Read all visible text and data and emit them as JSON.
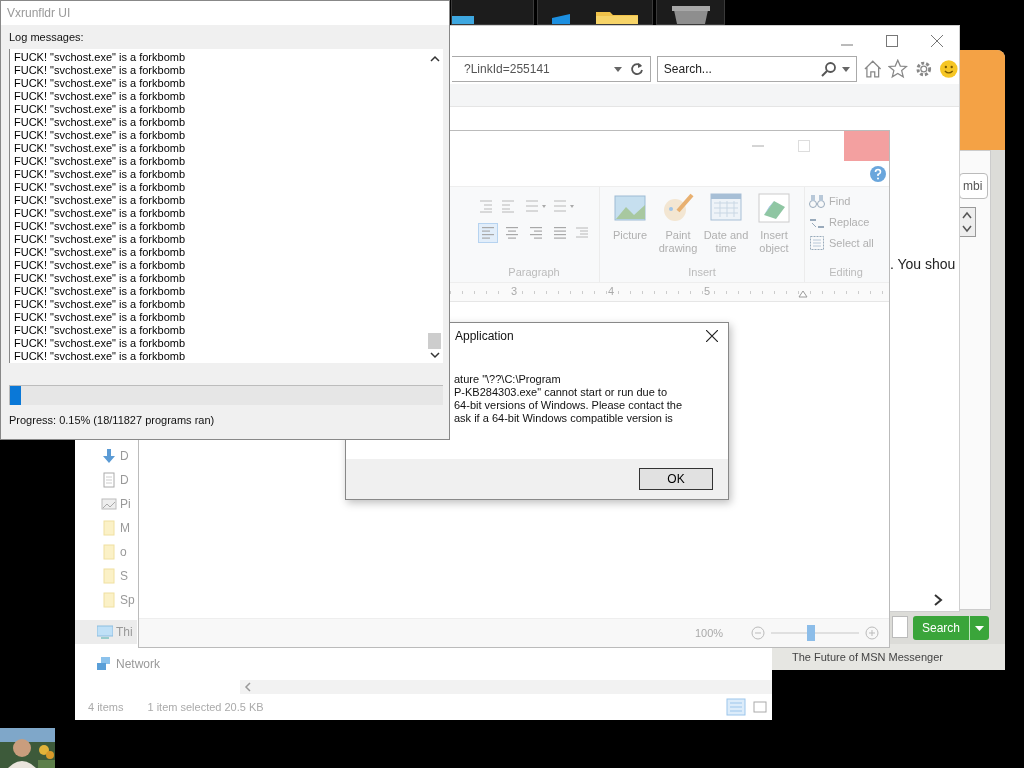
{
  "msn_window": {
    "field_value": "mbi",
    "search_button": "Search",
    "status": "The Future of MSN Messenger"
  },
  "explorer": {
    "nav_items": [
      {
        "label": "D",
        "kind": "download",
        "selected": false
      },
      {
        "label": "D",
        "kind": "document",
        "selected": false
      },
      {
        "label": "Pi",
        "kind": "picture",
        "selected": false
      },
      {
        "label": "M",
        "kind": "folder",
        "selected": false
      },
      {
        "label": "o",
        "kind": "folder",
        "selected": false
      },
      {
        "label": "S",
        "kind": "folder",
        "selected": false
      },
      {
        "label": "Sp",
        "kind": "folder",
        "selected": false
      },
      {
        "label": "Thi",
        "kind": "pc",
        "selected": true
      },
      {
        "label": "Network",
        "kind": "network",
        "selected": false
      }
    ],
    "status": [
      "4 items",
      "1 item selected  20.5 KB"
    ]
  },
  "browser": {
    "address": "?LinkId=255141",
    "search_placeholder": "Search...",
    "page_text": ". You shou"
  },
  "wordpad": {
    "alignment": [
      {
        "kind": "left",
        "selected": true
      },
      {
        "kind": "center",
        "selected": false
      },
      {
        "kind": "right",
        "selected": false
      },
      {
        "kind": "justify",
        "selected": false
      }
    ],
    "groups": [
      {
        "name": "Paragraph"
      },
      {
        "name": "Insert"
      },
      {
        "name": "Editing"
      }
    ],
    "insert_buttons": [
      {
        "label": "Picture",
        "kind": "picture"
      },
      {
        "label": "Paint drawing",
        "kind": "paint"
      },
      {
        "label": "Date and time",
        "kind": "calendar"
      },
      {
        "label": "Insert object",
        "kind": "object"
      }
    ],
    "editing_buttons": [
      {
        "label": "Find",
        "kind": "find"
      },
      {
        "label": "Replace",
        "kind": "replace"
      },
      {
        "label": "Select all",
        "kind": "select"
      }
    ],
    "ruler": [
      "3",
      "4",
      "5"
    ],
    "zoom": "100%",
    "zoom_slider": {
      "level": 0.45
    }
  },
  "dialog": {
    "title": "Application",
    "lines": [
      "ature \"\\??\\C:\\Program",
      "P-KB284303.exe\" cannot start or run due to",
      "64-bit versions of Windows. Please contact the",
      "ask if a 64-bit Windows compatible version is"
    ],
    "button": "OK"
  },
  "log_window": {
    "title": "Vxrunfldr UI",
    "label": "Log messages:",
    "lines": [
      "FUCK! \"svchost.exe\" is a forkbomb",
      "FUCK! \"svchost.exe\" is a forkbomb",
      "FUCK! \"svchost.exe\" is a forkbomb",
      "FUCK! \"svchost.exe\" is a forkbomb",
      "FUCK! \"svchost.exe\" is a forkbomb",
      "FUCK! \"svchost.exe\" is a forkbomb",
      "FUCK! \"svchost.exe\" is a forkbomb",
      "FUCK! \"svchost.exe\" is a forkbomb",
      "FUCK! \"svchost.exe\" is a forkbomb",
      "FUCK! \"svchost.exe\" is a forkbomb",
      "FUCK! \"svchost.exe\" is a forkbomb",
      "FUCK! \"svchost.exe\" is a forkbomb",
      "FUCK! \"svchost.exe\" is a forkbomb",
      "FUCK! \"svchost.exe\" is a forkbomb",
      "FUCK! \"svchost.exe\" is a forkbomb",
      "FUCK! \"svchost.exe\" is a forkbomb",
      "FUCK! \"svchost.exe\" is a forkbomb",
      "FUCK! \"svchost.exe\" is a forkbomb",
      "FUCK! \"svchost.exe\" is a forkbomb",
      "FUCK! \"svchost.exe\" is a forkbomb",
      "FUCK! \"svchost.exe\" is a forkbomb",
      "FUCK! \"svchost.exe\" is a forkbomb",
      "FUCK! \"svchost.exe\" is a forkbomb",
      "FUCK! \"svchost.exe\" is a forkbomb"
    ],
    "progress": {
      "level": 0.025
    },
    "status": "Progress: 0.15% (18/11827 programs ran)"
  }
}
